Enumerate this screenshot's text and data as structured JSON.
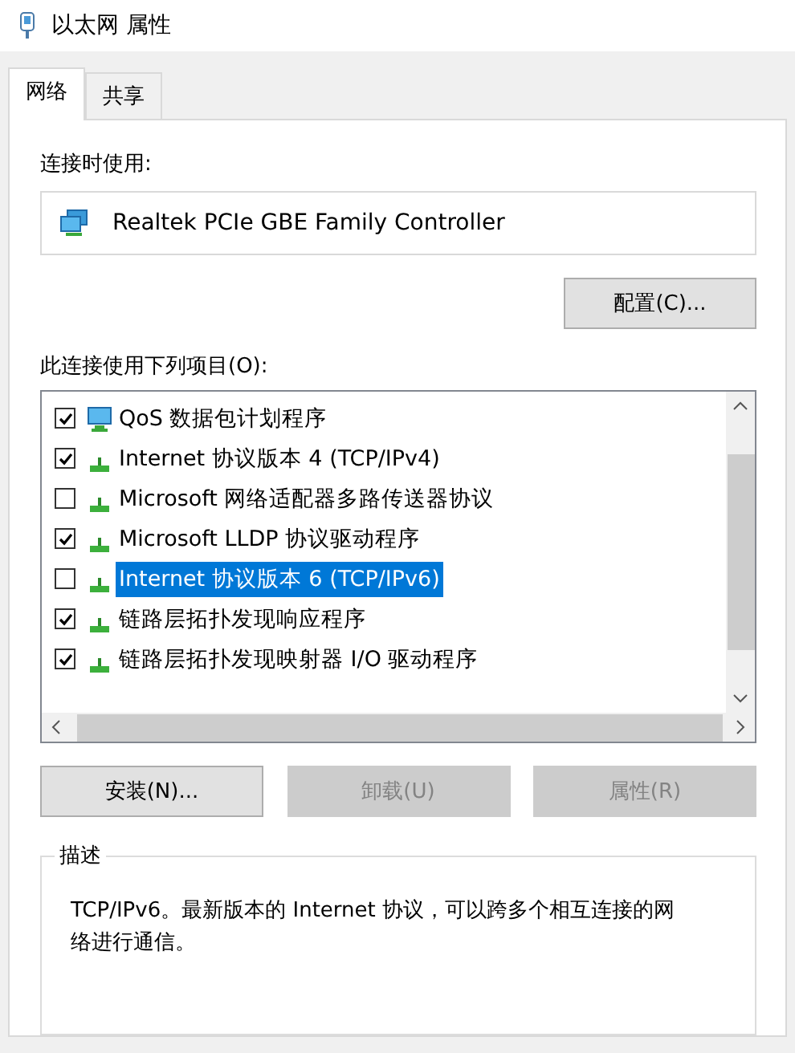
{
  "window": {
    "title": "以太网 属性"
  },
  "tabs": [
    {
      "label": "网络",
      "selected": true
    },
    {
      "label": "共享",
      "selected": false
    }
  ],
  "connect_using": {
    "label": "连接时使用:",
    "adapter": "Realtek PCIe GBE Family Controller",
    "configure_button": "配置(C)..."
  },
  "items_label": "此连接使用下列项目(O):",
  "items": [
    {
      "label": "QoS 数据包计划程序",
      "kind": "service",
      "checked": true,
      "selected": false
    },
    {
      "label": "Internet 协议版本 4 (TCP/IPv4)",
      "kind": "protocol",
      "checked": true,
      "selected": false
    },
    {
      "label": "Microsoft 网络适配器多路传送器协议",
      "kind": "protocol",
      "checked": false,
      "selected": false
    },
    {
      "label": "Microsoft LLDP 协议驱动程序",
      "kind": "protocol",
      "checked": true,
      "selected": false
    },
    {
      "label": "Internet 协议版本 6 (TCP/IPv6)",
      "kind": "protocol",
      "checked": false,
      "selected": true
    },
    {
      "label": "链路层拓扑发现响应程序",
      "kind": "protocol",
      "checked": true,
      "selected": false
    },
    {
      "label": "链路层拓扑发现映射器 I/O 驱动程序",
      "kind": "protocol",
      "checked": true,
      "selected": false
    }
  ],
  "buttons": [
    {
      "label": "安装(N)...",
      "disabled": false
    },
    {
      "label": "卸载(U)",
      "disabled": true
    },
    {
      "label": "属性(R)",
      "disabled": true
    }
  ],
  "description": {
    "label": "描述",
    "text": "TCP/IPv6。最新版本的 Internet 协议，可以跨多个相互连接的网络进行通信。"
  }
}
